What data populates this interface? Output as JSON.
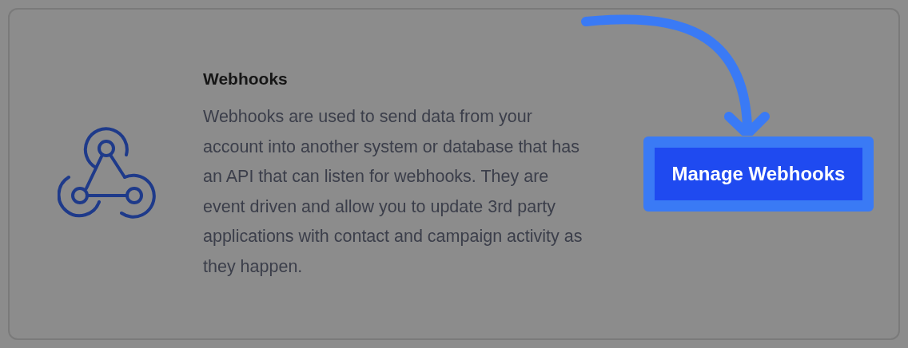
{
  "card": {
    "title": "Webhooks",
    "description": "Webhooks are used to send data from your account into another system or database that has an API that can listen for webhooks. They are event driven and allow you to update 3rd party applications with contact and campaign activity as they happen.",
    "button": {
      "label": "Manage Webhooks",
      "highlighted": true
    }
  }
}
